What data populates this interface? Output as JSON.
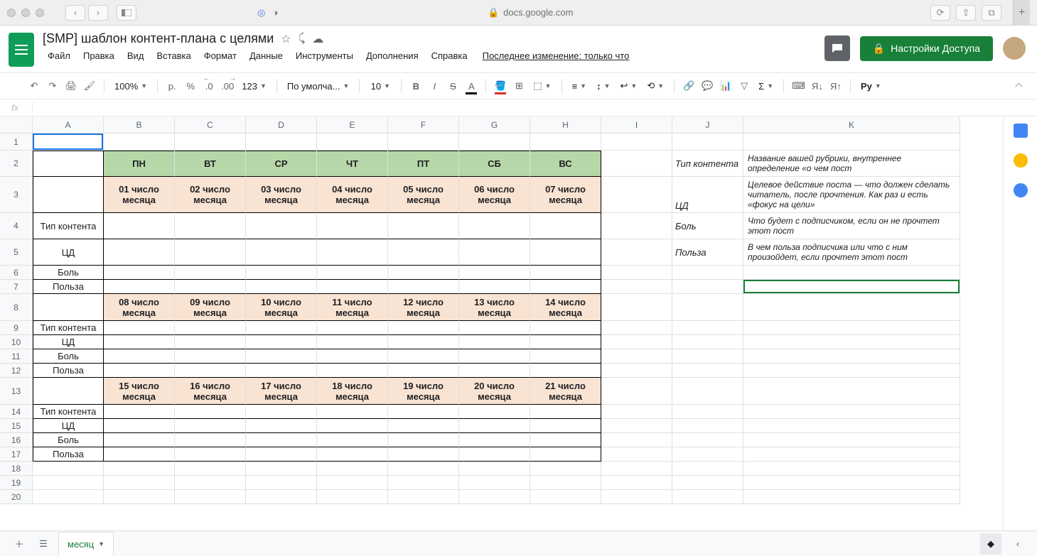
{
  "browser": {
    "url": "docs.google.com",
    "addtab": "+"
  },
  "doc": {
    "title": "[SMP] шаблон контент-плана с целями",
    "menus": [
      "Файл",
      "Правка",
      "Вид",
      "Вставка",
      "Формат",
      "Данные",
      "Инструменты",
      "Дополнения",
      "Справка"
    ],
    "last_edit": "Последнее изменение: только что",
    "share": "Настройки Доступа"
  },
  "toolbar": {
    "zoom": "100%",
    "currency": "р.",
    "percent": "%",
    "dec_dec": ".0",
    "dec_inc": ".00",
    "num_fmt": "123",
    "font": "По умолча...",
    "size": "10",
    "py": "Py"
  },
  "fx": {
    "label": "fx"
  },
  "columns": [
    "A",
    "B",
    "C",
    "D",
    "E",
    "F",
    "G",
    "H",
    "I",
    "J",
    "K"
  ],
  "sheet": {
    "days": [
      "ПН",
      "ВТ",
      "СР",
      "ЧТ",
      "ПТ",
      "СБ",
      "ВС"
    ],
    "weeks": [
      [
        "01 число месяца",
        "02 число месяца",
        "03 число месяца",
        "04 число месяца",
        "05 число месяца",
        "06 число месяца",
        "07 число месяца"
      ],
      [
        "08 число месяца",
        "09 число месяца",
        "10 число месяца",
        "11 число месяца",
        "12 число месяца",
        "13 число месяца",
        "14 число месяца"
      ],
      [
        "15 число месяца",
        "16 число месяца",
        "17 число месяца",
        "18 число месяца",
        "19 число месяца",
        "20 число месяца",
        "21 число месяца"
      ]
    ],
    "rowlabels": [
      "Тип контента",
      "ЦД",
      "Боль",
      "Польза"
    ],
    "j": [
      "Тип контента",
      "ЦД",
      "Боль",
      "Польза"
    ],
    "k": [
      "Название вашей рубрики, внутреннее определение «о чем пост",
      "Целевое действие поста — что должен сделать читатель, после прочтения. Как раз и есть «фокус на цели»",
      "Что будет с подписчиком, если он не прочтет этот пост",
      "В чем польза подписчика или что с ним произойдет, если прочтет этот пост"
    ]
  },
  "bottom": {
    "tab": "месяц"
  }
}
